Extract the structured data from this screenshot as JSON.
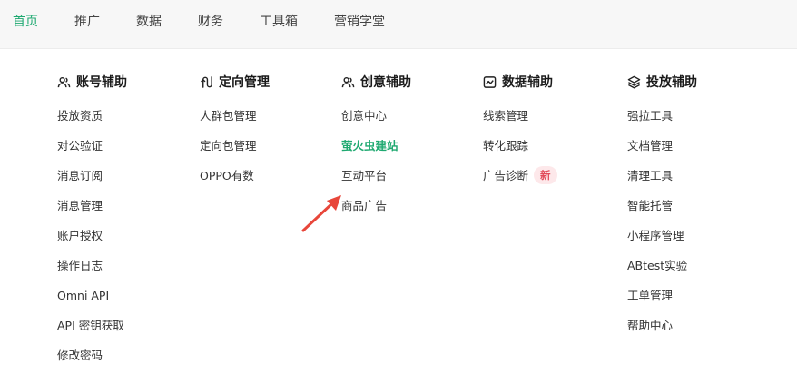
{
  "colors": {
    "accent": "#1fa971",
    "badge_bg": "#fde8ea",
    "badge_text": "#e24b5a",
    "arrow": "#e8463a"
  },
  "topnav": {
    "items": [
      {
        "label": "首页",
        "active": true
      },
      {
        "label": "推广"
      },
      {
        "label": "数据"
      },
      {
        "label": "财务"
      },
      {
        "label": "工具箱"
      },
      {
        "label": "营销学堂"
      }
    ]
  },
  "menu": {
    "columns": [
      {
        "title": "账号辅助",
        "icon": "user-group-icon",
        "items": [
          "投放资质",
          "对公验证",
          "消息订阅",
          "消息管理",
          "账户授权",
          "操作日志",
          "Omni API",
          "API 密钥获取",
          "修改密码"
        ]
      },
      {
        "title": "定向管理",
        "icon": "target-path-icon",
        "items": [
          "人群包管理",
          "定向包管理",
          "OPPO有数"
        ]
      },
      {
        "title": "创意辅助",
        "icon": "user-group-icon",
        "items": [
          "创意中心",
          "萤火虫建站",
          "互动平台",
          "商品广告"
        ]
      },
      {
        "title": "数据辅助",
        "icon": "line-chart-icon",
        "items": [
          "线索管理",
          "转化跟踪",
          "广告诊断"
        ],
        "badge": "新"
      },
      {
        "title": "投放辅助",
        "icon": "layers-icon",
        "items": [
          "强拉工具",
          "文档管理",
          "清理工具",
          "智能托管",
          "小程序管理",
          "ABtest实验",
          "工单管理",
          "帮助中心"
        ]
      }
    ]
  }
}
